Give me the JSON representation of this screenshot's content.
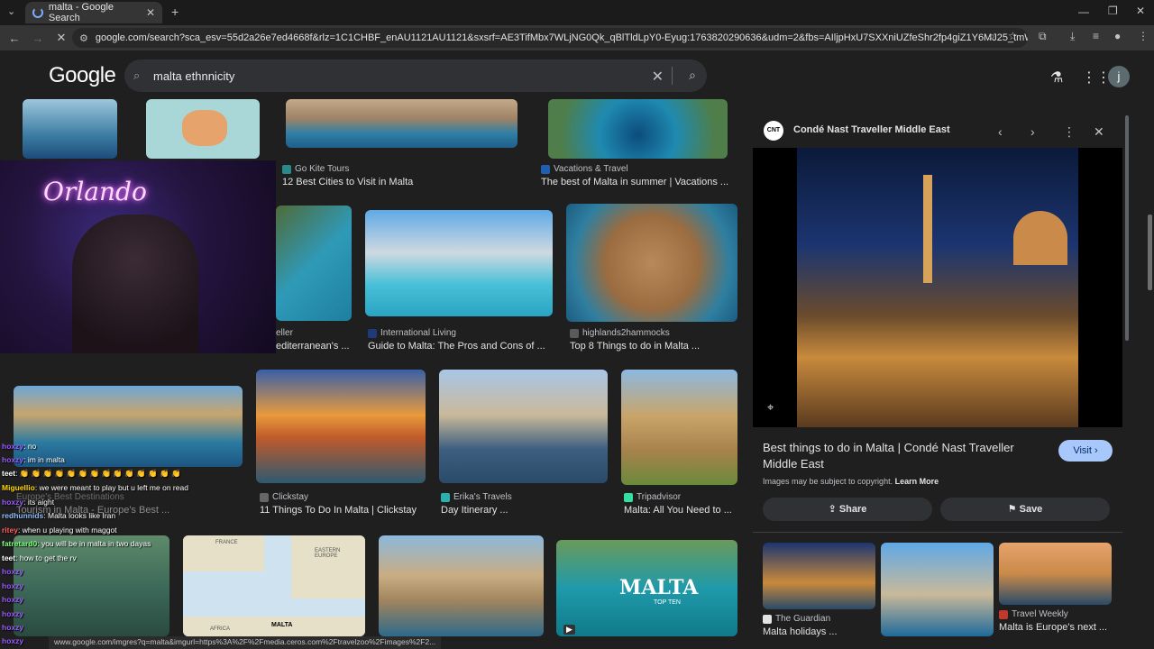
{
  "browser": {
    "tab_title": "malta - Google Search",
    "url": "google.com/search?sca_esv=55d2a26e7ed4668f&rlz=1C1CHBF_enAU1121AU1121&sxsrf=AE3TifMbx7WLjNG0Qk_qBlTldLpY0-Eyug:1763820290636&udm=2&fbs=AIljpHxU7SXXniUZfeShr2fp4giZ1Y6MJ25_tmWITc7uy4KleqDdErwP5rACeJA...",
    "avatar_letter": "j",
    "status_url": "www.google.com/imgres?q=malta&imgurl=https%3A%2F%2Fmedia.ceros.com%2Ftravelzoo%2Fimages%2F2..."
  },
  "search": {
    "logo": "Google",
    "query": "malta ethnnicity"
  },
  "grid": [
    {
      "source": "Go Kite Tours",
      "title": "12 Best Cities to Visit in Malta",
      "fav": "#2a8a8a"
    },
    {
      "source": "Vacations & Travel",
      "title": "The best of Malta in summer | Vacations ...",
      "fav": "#1f5fb0"
    },
    {
      "source": "eller",
      "title": "editerranean's ...",
      "fav": "#555555"
    },
    {
      "source": "International Living",
      "title": "Guide to Malta: The Pros and Cons of ...",
      "fav": "#1f3a7a"
    },
    {
      "source": "highlands2hammocks",
      "title": "Top 8 Things to do in Malta ...",
      "fav": "#5a5a5a"
    },
    {
      "source": "Europe's Best Destinations",
      "title": "Tourism in Malta - Europe's Best ...",
      "fav": "#333333"
    },
    {
      "source": "Clickstay",
      "title": "11 Things To Do In Malta | Clickstay",
      "fav": "#666666"
    },
    {
      "source": "Erika's Travels",
      "title": "Day Itinerary ...",
      "fav": "#2ab0b0"
    },
    {
      "source": "Tripadvisor",
      "title": "Malta: All You Need to ...",
      "fav": "#34e0a1"
    }
  ],
  "overlay_images": {
    "map_labels": [
      "FRANCE",
      "EASTERN EUROPE",
      "AFRICA",
      "MALTA"
    ],
    "malta_top_ten": [
      "MALTA",
      "TOP TEN"
    ]
  },
  "chat": [
    {
      "user": "hoxzy",
      "msg": ": no",
      "color": "#9b59ff"
    },
    {
      "user": "hoxzy",
      "msg": ": im in malta",
      "color": "#9b59ff"
    },
    {
      "user": "teet",
      "msg": ": 👏 👏 👏 👏 👏 👏 👏 👏 👏 👏 👏 👏 👏 👏",
      "color": "#ffffff"
    },
    {
      "user": "Miguellio",
      "msg": ": we were meant to play but u left me on read",
      "color": "#ffd700"
    },
    {
      "user": "hoxzy",
      "msg": ": its aight",
      "color": "#9b59ff"
    },
    {
      "user": "redhunnids",
      "msg": ": Malta looks like Iran",
      "color": "#8fbfff"
    },
    {
      "user": "ritey",
      "msg": ": when u playing with maggot",
      "color": "#ff6060"
    },
    {
      "user": "fatretard0",
      "msg": ": you will be in malta in two dayas",
      "color": "#7cff7c"
    },
    {
      "user": "teet",
      "msg": ": how to get the rv",
      "color": "#ffffff"
    },
    {
      "user": "hoxzy",
      "msg": "",
      "color": "#9b59ff"
    },
    {
      "user": "hoxzy",
      "msg": "",
      "color": "#9b59ff"
    },
    {
      "user": "hoxzy",
      "msg": "",
      "color": "#9b59ff"
    },
    {
      "user": "hoxzy",
      "msg": "",
      "color": "#9b59ff"
    },
    {
      "user": "hoxzy",
      "msg": "",
      "color": "#9b59ff"
    },
    {
      "user": "hoxzy",
      "msg": "",
      "color": "#9b59ff"
    }
  ],
  "panel": {
    "favicon_text": "CNT",
    "source": "Condé Nast Traveller Middle East",
    "title": "Best things to do in Malta | Condé Nast Traveller Middle East",
    "visit": "Visit",
    "copyright": "Images may be subject to copyright.",
    "learn_more": "Learn More",
    "share": "Share",
    "save": "Save",
    "related": [
      {
        "source": "The Guardian",
        "title": "Malta holidays ..."
      },
      {
        "source": "",
        "title": ""
      },
      {
        "source": "Travel Weekly",
        "title": "Malta is Europe's next ..."
      }
    ]
  },
  "colors": {
    "accent": "#a8c7fa",
    "bg": "#1f1f1f"
  }
}
